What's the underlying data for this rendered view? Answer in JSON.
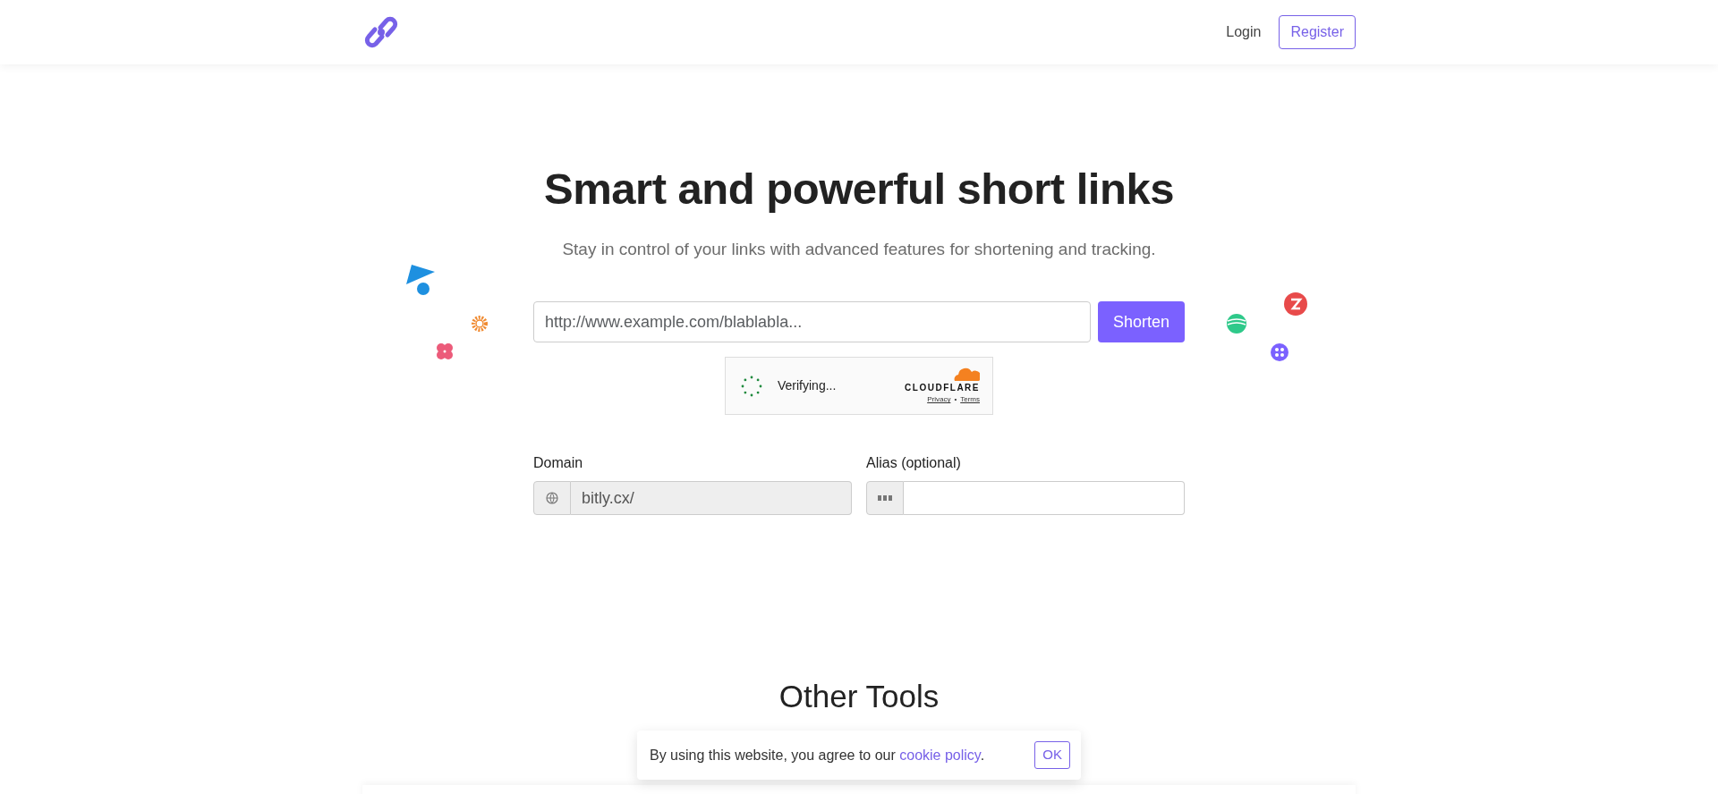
{
  "nav": {
    "links": [
      {
        "label": "Login",
        "kind": "link"
      },
      {
        "label": "Register",
        "kind": "outline"
      }
    ]
  },
  "hero": {
    "title": "Smart and powerful short links",
    "subtitle": "Stay in control of your links with advanced features for shortening and tracking.",
    "url_field": {
      "placeholder": "http://www.example.com/blablabla..."
    },
    "submit": "Shorten",
    "captcha": {
      "status": "Verifying...",
      "brand": "CLOUDFLARE",
      "links": [
        "Privacy",
        "Terms"
      ],
      "separator": "•"
    },
    "domain": {
      "label": "Domain",
      "value": "bitly.cx/",
      "disabled": true
    },
    "alias": {
      "label": "Alias (optional)"
    }
  },
  "other_tools": {
    "title": "Other Tools"
  },
  "cookie": {
    "text": "By using this website, you agree to our ",
    "link": "cookie policy",
    "text_after": ".",
    "button": "OK"
  }
}
